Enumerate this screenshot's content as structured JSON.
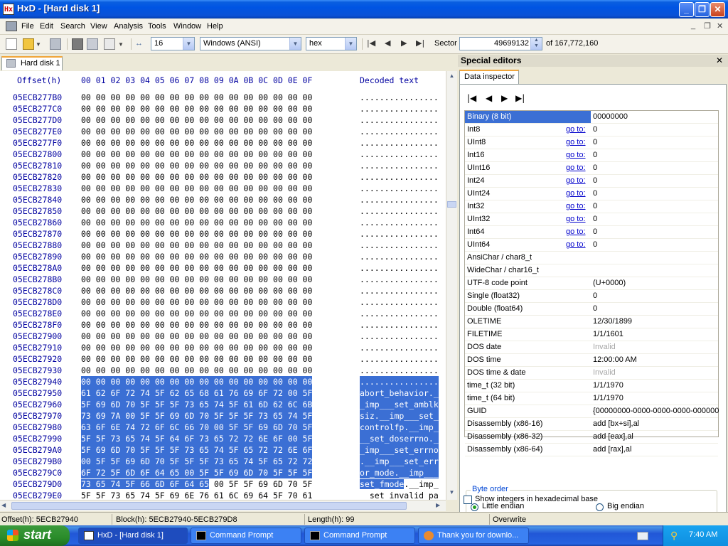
{
  "window": {
    "title": "HxD - [Hard disk 1]",
    "icon_text": "Hx"
  },
  "menu": [
    "File",
    "Edit",
    "Search",
    "View",
    "Analysis",
    "Tools",
    "Window",
    "Help"
  ],
  "toolbar": {
    "bytes_per_row": "16",
    "charset": "Windows (ANSI)",
    "display_mode": "hex",
    "sector_label": "Sector",
    "sector_value": "49699132",
    "sector_total": "of 167,772,160"
  },
  "tab": {
    "label": "Hard disk 1"
  },
  "hex": {
    "offset_header": "Offset(h)",
    "columns_header": "00 01 02 03 04 05 06 07 08 09 0A 0B 0C 0D 0E 0F",
    "decoded_header": "Decoded text",
    "rows": [
      {
        "offset": "05ECB277B0",
        "hex": "00 00 00 00 00 00 00 00 00 00 00 00 00 00 00 00",
        "text": "................"
      },
      {
        "offset": "05ECB277C0",
        "hex": "00 00 00 00 00 00 00 00 00 00 00 00 00 00 00 00",
        "text": "................"
      },
      {
        "offset": "05ECB277D0",
        "hex": "00 00 00 00 00 00 00 00 00 00 00 00 00 00 00 00",
        "text": "................"
      },
      {
        "offset": "05ECB277E0",
        "hex": "00 00 00 00 00 00 00 00 00 00 00 00 00 00 00 00",
        "text": "................"
      },
      {
        "offset": "05ECB277F0",
        "hex": "00 00 00 00 00 00 00 00 00 00 00 00 00 00 00 00",
        "text": "................"
      },
      {
        "offset": "05ECB27800",
        "hex": "00 00 00 00 00 00 00 00 00 00 00 00 00 00 00 00",
        "text": "................"
      },
      {
        "offset": "05ECB27810",
        "hex": "00 00 00 00 00 00 00 00 00 00 00 00 00 00 00 00",
        "text": "................"
      },
      {
        "offset": "05ECB27820",
        "hex": "00 00 00 00 00 00 00 00 00 00 00 00 00 00 00 00",
        "text": "................"
      },
      {
        "offset": "05ECB27830",
        "hex": "00 00 00 00 00 00 00 00 00 00 00 00 00 00 00 00",
        "text": "................"
      },
      {
        "offset": "05ECB27840",
        "hex": "00 00 00 00 00 00 00 00 00 00 00 00 00 00 00 00",
        "text": "................"
      },
      {
        "offset": "05ECB27850",
        "hex": "00 00 00 00 00 00 00 00 00 00 00 00 00 00 00 00",
        "text": "................"
      },
      {
        "offset": "05ECB27860",
        "hex": "00 00 00 00 00 00 00 00 00 00 00 00 00 00 00 00",
        "text": "................"
      },
      {
        "offset": "05ECB27870",
        "hex": "00 00 00 00 00 00 00 00 00 00 00 00 00 00 00 00",
        "text": "................"
      },
      {
        "offset": "05ECB27880",
        "hex": "00 00 00 00 00 00 00 00 00 00 00 00 00 00 00 00",
        "text": "................"
      },
      {
        "offset": "05ECB27890",
        "hex": "00 00 00 00 00 00 00 00 00 00 00 00 00 00 00 00",
        "text": "................"
      },
      {
        "offset": "05ECB278A0",
        "hex": "00 00 00 00 00 00 00 00 00 00 00 00 00 00 00 00",
        "text": "................"
      },
      {
        "offset": "05ECB278B0",
        "hex": "00 00 00 00 00 00 00 00 00 00 00 00 00 00 00 00",
        "text": "................"
      },
      {
        "offset": "05ECB278C0",
        "hex": "00 00 00 00 00 00 00 00 00 00 00 00 00 00 00 00",
        "text": "................"
      },
      {
        "offset": "05ECB278D0",
        "hex": "00 00 00 00 00 00 00 00 00 00 00 00 00 00 00 00",
        "text": "................"
      },
      {
        "offset": "05ECB278E0",
        "hex": "00 00 00 00 00 00 00 00 00 00 00 00 00 00 00 00",
        "text": "................"
      },
      {
        "offset": "05ECB278F0",
        "hex": "00 00 00 00 00 00 00 00 00 00 00 00 00 00 00 00",
        "text": "................"
      },
      {
        "offset": "05ECB27900",
        "hex": "00 00 00 00 00 00 00 00 00 00 00 00 00 00 00 00",
        "text": "................"
      },
      {
        "offset": "05ECB27910",
        "hex": "00 00 00 00 00 00 00 00 00 00 00 00 00 00 00 00",
        "text": "................"
      },
      {
        "offset": "05ECB27920",
        "hex": "00 00 00 00 00 00 00 00 00 00 00 00 00 00 00 00",
        "text": "................"
      },
      {
        "offset": "05ECB27930",
        "hex": "00 00 00 00 00 00 00 00 00 00 00 00 00 00 00 00",
        "text": "................"
      },
      {
        "offset": "05ECB27940",
        "hex": "00 00 00 00 00 00 00 00 00 00 00 00 00 00 00 00",
        "text": "................",
        "selected": true
      },
      {
        "offset": "05ECB27950",
        "hex": "61 62 6F 72 74 5F 62 65 68 61 76 69 6F 72 00 5F",
        "text": "abort_behavior._",
        "selected": true
      },
      {
        "offset": "05ECB27960",
        "hex": "5F 69 6D 70 5F 5F 5F 73 65 74 5F 61 6D 62 6C 6B",
        "text": "_imp___set_amblk",
        "selected": true
      },
      {
        "offset": "05ECB27970",
        "hex": "73 69 7A 00 5F 5F 69 6D 70 5F 5F 5F 73 65 74 5F",
        "text": "siz.__imp___set_",
        "selected": true
      },
      {
        "offset": "05ECB27980",
        "hex": "63 6F 6E 74 72 6F 6C 66 70 00 5F 5F 69 6D 70 5F",
        "text": "controlfp.__imp_",
        "selected": true
      },
      {
        "offset": "05ECB27990",
        "hex": "5F 5F 73 65 74 5F 64 6F 73 65 72 72 6E 6F 00 5F",
        "text": "__set_doserrno._",
        "selected": true
      },
      {
        "offset": "05ECB279A0",
        "hex": "5F 69 6D 70 5F 5F 5F 73 65 74 5F 65 72 72 6E 6F",
        "text": "_imp___set_errno",
        "selected": true
      },
      {
        "offset": "05ECB279B0",
        "hex": "00 5F 5F 69 6D 70 5F 5F 5F 73 65 74 5F 65 72 72",
        "text": ".__imp___set_err",
        "selected": true
      },
      {
        "offset": "05ECB279C0",
        "hex": "6F 72 5F 6D 6F 64 65 00 5F 5F 69 6D 70 5F 5F 5F",
        "text": "or_mode.__imp___",
        "selected": true
      },
      {
        "offset": "05ECB279D0",
        "hex": "73 65 74 5F 66 6D 6F 64 65 00 5F 5F 69 6D 70 5F",
        "text": "set_fmode.__imp_",
        "sel_bytes": 9
      },
      {
        "offset": "05ECB279E0",
        "hex": "5F 5F 73 65 74 5F 69 6E 76 61 6C 69 64 5F 70 61",
        "text": "__set_invalid_pa"
      }
    ]
  },
  "special": {
    "title": "Special editors",
    "tab_label": "Data inspector",
    "goto_label": "go to:",
    "rows": [
      {
        "label": "Binary (8 bit)",
        "value": "00000000",
        "selected": true
      },
      {
        "label": "Int8",
        "value": "0",
        "goto": true
      },
      {
        "label": "UInt8",
        "value": "0",
        "goto": true
      },
      {
        "label": "Int16",
        "value": "0",
        "goto": true
      },
      {
        "label": "UInt16",
        "value": "0",
        "goto": true
      },
      {
        "label": "Int24",
        "value": "0",
        "goto": true
      },
      {
        "label": "UInt24",
        "value": "0",
        "goto": true
      },
      {
        "label": "Int32",
        "value": "0",
        "goto": true
      },
      {
        "label": "UInt32",
        "value": "0",
        "goto": true
      },
      {
        "label": "Int64",
        "value": "0",
        "goto": true
      },
      {
        "label": "UInt64",
        "value": "0",
        "goto": true
      },
      {
        "label": "AnsiChar / char8_t",
        "value": ""
      },
      {
        "label": "WideChar / char16_t",
        "value": ""
      },
      {
        "label": "UTF-8 code point",
        "value": " (U+0000)"
      },
      {
        "label": "Single (float32)",
        "value": "0"
      },
      {
        "label": "Double (float64)",
        "value": "0"
      },
      {
        "label": "OLETIME",
        "value": "12/30/1899"
      },
      {
        "label": "FILETIME",
        "value": "1/1/1601"
      },
      {
        "label": "DOS date",
        "value": "Invalid",
        "invalid": true
      },
      {
        "label": "DOS time",
        "value": "12:00:00 AM"
      },
      {
        "label": "DOS time & date",
        "value": "Invalid",
        "invalid": true
      },
      {
        "label": "time_t (32 bit)",
        "value": "1/1/1970"
      },
      {
        "label": "time_t (64 bit)",
        "value": "1/1/1970"
      },
      {
        "label": "GUID",
        "value": "{00000000-0000-0000-0000-000000"
      },
      {
        "label": "Disassembly (x86-16)",
        "value": "add [bx+si],al"
      },
      {
        "label": "Disassembly (x86-32)",
        "value": "add [eax],al"
      },
      {
        "label": "Disassembly (x86-64)",
        "value": "add [rax],al"
      }
    ],
    "byte_order_label": "Byte order",
    "little_endian": "Little endian",
    "big_endian": "Big endian",
    "show_hex_label": "Show integers in hexadecimal base"
  },
  "status": {
    "offset": "Offset(h): 5ECB27940",
    "block": "Block(h): 5ECB27940-5ECB279D8",
    "length": "Length(h): 99",
    "mode": "Overwrite"
  },
  "taskbar": {
    "start": "start",
    "tasks": [
      "HxD - [Hard disk 1]",
      "Command Prompt",
      "Command Prompt",
      "Thank you for downlo..."
    ],
    "clock": "7:40 AM"
  },
  "colors": {
    "selection": "#3b6fd4",
    "offset_blue": "#0000a0",
    "title_blue": "#0054e3"
  }
}
